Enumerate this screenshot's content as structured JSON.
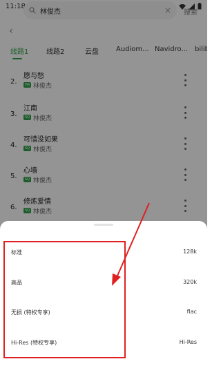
{
  "status_bar": {
    "time": "11:18",
    "notification_icon": "A"
  },
  "search": {
    "query": "林俊杰",
    "submit_label": "搜索"
  },
  "tabs": [
    {
      "label": "线路1",
      "active": true
    },
    {
      "label": "线路2",
      "active": false
    },
    {
      "label": "云盘",
      "active": false
    },
    {
      "label": "Audiom...",
      "active": false
    },
    {
      "label": "Navidro...",
      "active": false
    },
    {
      "label": "bilibi",
      "active": false
    }
  ],
  "songs": [
    {
      "index": "2.",
      "title": "愿与愁",
      "quality": "HR",
      "artist": "林俊杰"
    },
    {
      "index": "3.",
      "title": "江南",
      "quality": "SQ",
      "artist": "林俊杰"
    },
    {
      "index": "4.",
      "title": "可惜没如果",
      "quality": "SQ",
      "artist": "林俊杰"
    },
    {
      "index": "5.",
      "title": "心墙",
      "quality": "SQ",
      "artist": "林俊杰"
    },
    {
      "index": "6.",
      "title": "修炼爱情",
      "quality": "SQ",
      "artist": "林俊杰"
    }
  ],
  "quality_sheet": {
    "options": [
      {
        "label": "标准",
        "value": "128k"
      },
      {
        "label": "高品",
        "value": "320k"
      },
      {
        "label": "无损 (特权专享)",
        "value": "flac"
      },
      {
        "label": "Hi-Res (特权专享)",
        "value": "Hi-Res"
      }
    ]
  },
  "colors": {
    "accent": "#2fa047",
    "annotation": "#e02020",
    "scrim": "rgba(0,0,0,0.42)"
  }
}
